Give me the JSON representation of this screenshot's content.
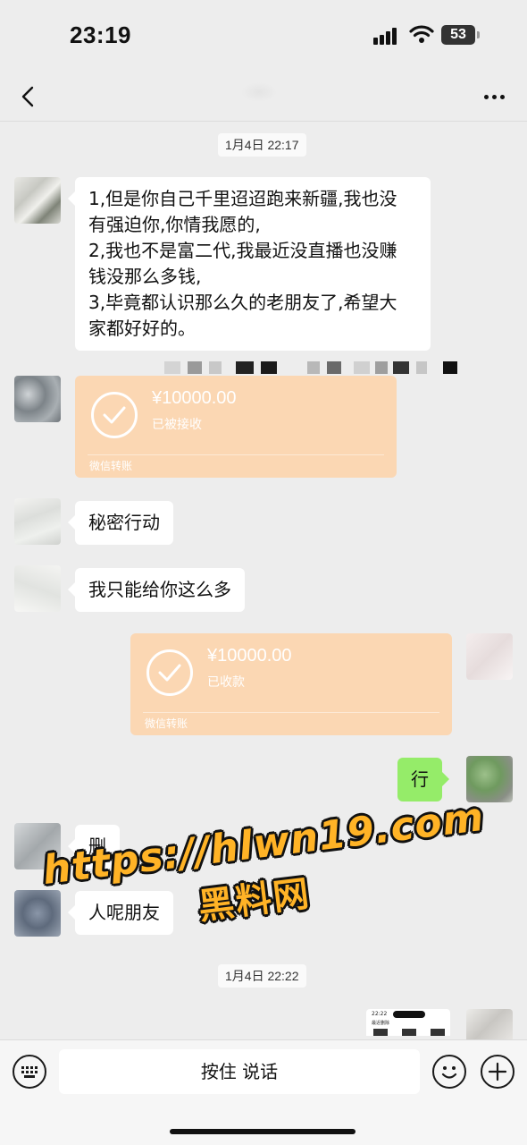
{
  "status_bar": {
    "time": "23:19",
    "battery": "53"
  },
  "nav": {
    "back_icon": "chevron-left-icon",
    "more_icon": "ellipsis-icon"
  },
  "chat": {
    "timestamp_1": "1月4日 22:17",
    "timestamp_2": "1月4日 22:22",
    "msg_1_lines": [
      "1,但是你自己千里迢迢跑来新疆,我也没",
      "有强迫你,你情我愿的,",
      "2,我也不是富二代,我最近没直播也没赚",
      "钱没那么多钱,",
      "3,毕竟都认识那么久的老朋友了,希望大",
      "家都好好的。"
    ],
    "transfer_in": {
      "amount": "¥10000.00",
      "status": "已被接收",
      "brand": "微信转账"
    },
    "msg_2": "秘密行动",
    "msg_3": "我只能给你这么多",
    "transfer_out": {
      "amount": "¥10000.00",
      "status": "已收款",
      "brand": "微信转账"
    },
    "msg_4_right": "行",
    "msg_5": "删",
    "msg_6": "人呢朋友",
    "thumbnail": {
      "time": "22:22",
      "label": "最近删除"
    }
  },
  "watermark": {
    "url": "https://hlwn19.com",
    "name": "黑料网"
  },
  "input_bar": {
    "hold_to_talk": "按住 说话",
    "keyboard_icon": "keyboard-icon",
    "emoji_icon": "emoji-icon",
    "plus_icon": "plus-icon"
  },
  "colors": {
    "background": "#ededed",
    "bubble_left": "#ffffff",
    "bubble_right": "#95ec69",
    "transfer_card": "#fbd7b3",
    "watermark": "#ffb326"
  }
}
